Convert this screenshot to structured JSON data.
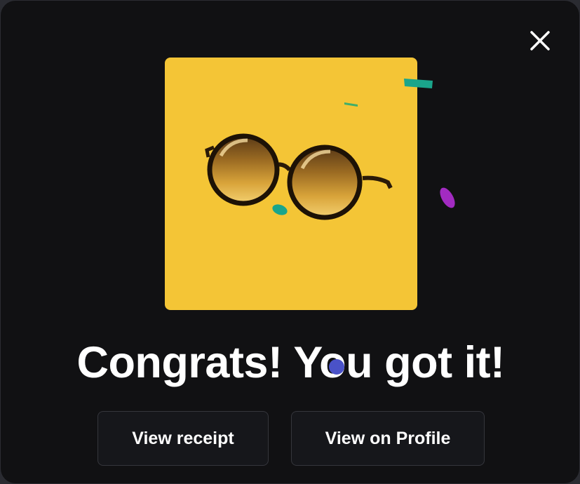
{
  "dialog": {
    "headline": "Congrats! You got it!",
    "close_icon": "close-icon",
    "artwork_icon": "pixel-sunglasses-icon",
    "buttons": {
      "view_receipt": "View receipt",
      "view_on_profile": "View on Profile"
    }
  },
  "colors": {
    "background": "#111113",
    "artwork_background": "#f4c536",
    "button_background": "#16171b",
    "button_border": "#35363c",
    "text": "#ffffff",
    "confetti_teal": "#1aa58b",
    "confetti_green": "#3fae6a",
    "confetti_purple": "#a22bc1",
    "confetti_blue": "#4a52c8"
  }
}
